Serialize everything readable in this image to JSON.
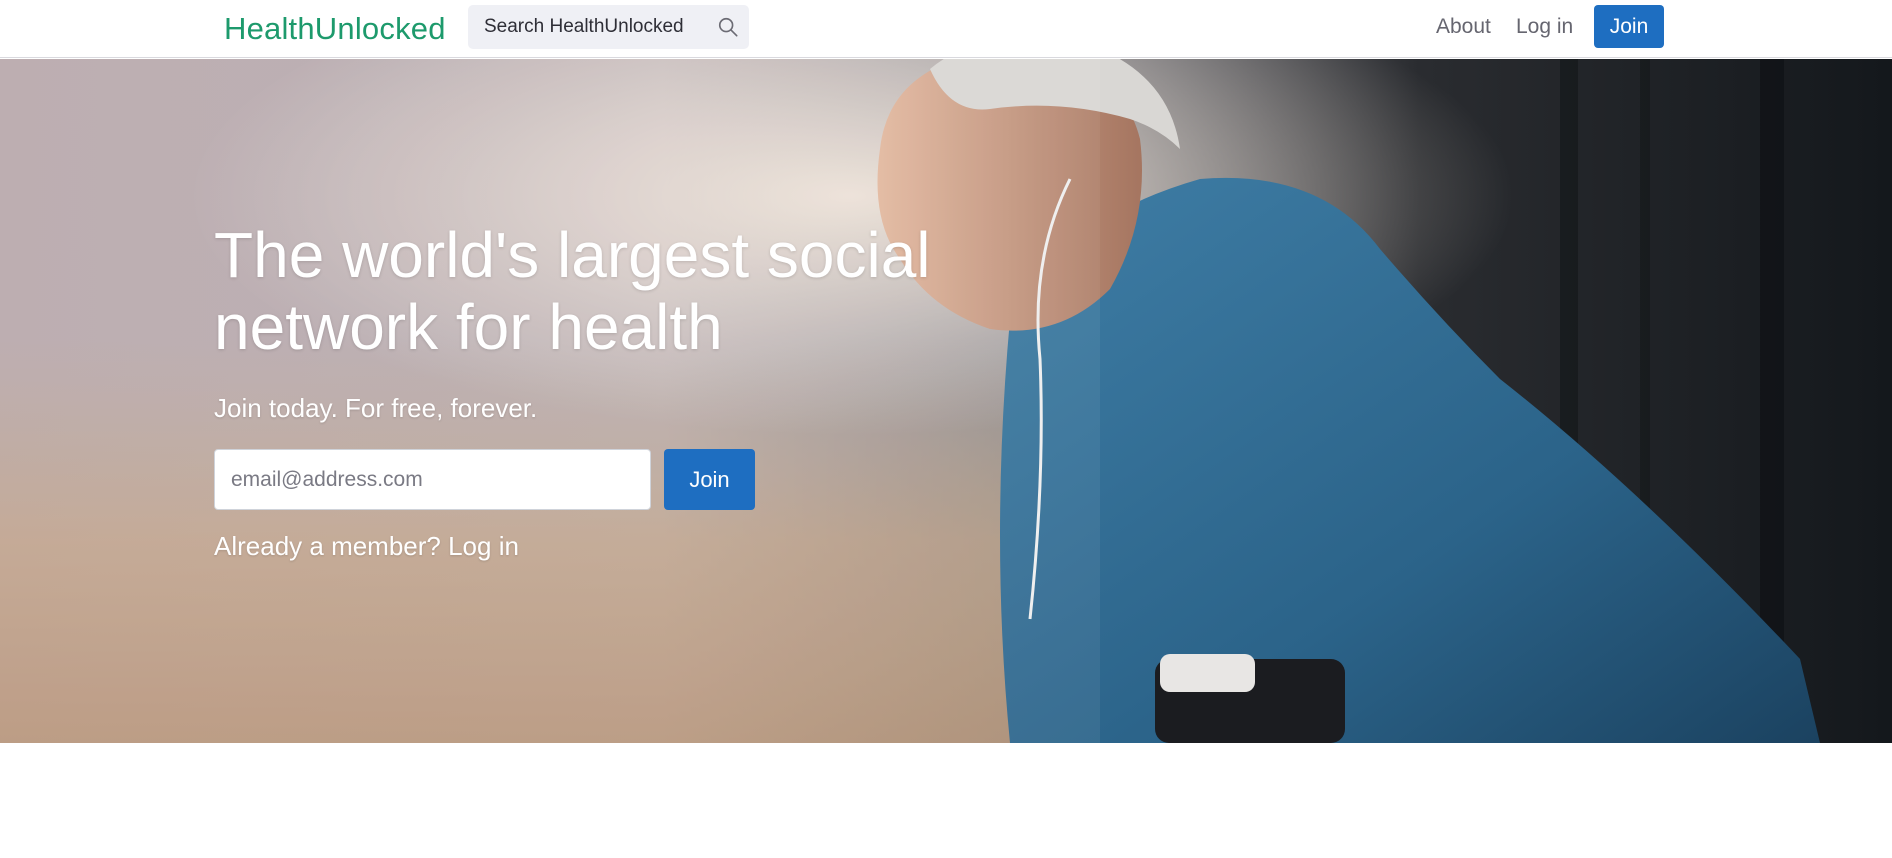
{
  "header": {
    "logo": "HealthUnlocked",
    "search_text": "Search HealthUnlocked",
    "search_icon": "search-icon",
    "nav": {
      "about": "About",
      "login": "Log in",
      "join": "Join"
    }
  },
  "hero": {
    "title": "The world's largest social network for health",
    "subtitle": "Join today. For free, forever.",
    "email_placeholder": "email@address.com",
    "join_button": "Join",
    "member_text": "Already a member? Log in"
  },
  "colors": {
    "brand_green": "#1d9a6c",
    "primary_blue": "#1e6ec1",
    "search_bg": "#eff0f5"
  }
}
